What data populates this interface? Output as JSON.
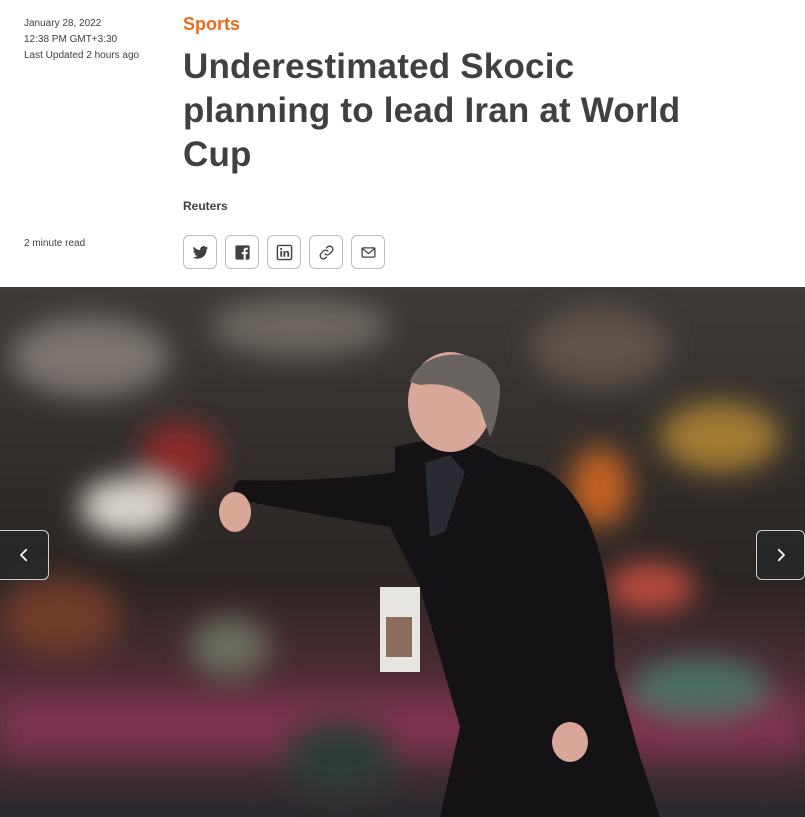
{
  "meta": {
    "date": "January 28, 2022",
    "time": "12:38 PM GMT+3:30",
    "updated": "Last Updated 2 hours ago",
    "read_time": "2 minute read"
  },
  "article": {
    "section": "Sports",
    "headline": "Underestimated Skocic planning to lead Iran at World Cup",
    "author": "Reuters"
  },
  "share": {
    "icons": [
      "twitter-icon",
      "facebook-icon",
      "linkedin-icon",
      "link-icon",
      "email-icon"
    ]
  },
  "colors": {
    "accent": "#eb6a17",
    "text": "#404040",
    "border": "#bdbdbd"
  },
  "gallery": {
    "prev_icon": "chevron-left-icon",
    "next_icon": "chevron-right-icon"
  }
}
